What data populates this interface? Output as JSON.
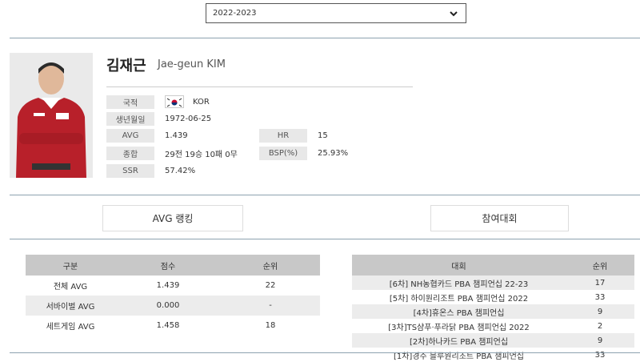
{
  "season": {
    "selected": "2022-2023"
  },
  "player": {
    "name_ko": "김재근",
    "name_en": "Jae-geun KIM",
    "info": {
      "nationality_label": "국적",
      "nationality_value": "KOR",
      "birth_label": "생년월일",
      "birth_value": "1972-06-25",
      "avg_label": "AVG",
      "avg_value": "1.439",
      "hr_label": "HR",
      "hr_value": "15",
      "total_label": "종합",
      "total_value": "29전 19승 10패 0무",
      "bsp_label": "BSP(%)",
      "bsp_value": "25.93%",
      "ssr_label": "SSR",
      "ssr_value": "57.42%"
    }
  },
  "tabs": {
    "avg_ranking": "AVG 랭킹",
    "tournaments": "참여대회"
  },
  "avg_table": {
    "headers": [
      "구분",
      "점수",
      "순위"
    ],
    "rows": [
      [
        "전체 AVG",
        "1.439",
        "22"
      ],
      [
        "서바이벌 AVG",
        "0.000",
        "-"
      ],
      [
        "세트게임 AVG",
        "1.458",
        "18"
      ]
    ]
  },
  "tour_table": {
    "headers": [
      "대회",
      "순위"
    ],
    "rows": [
      [
        "[6차] NH농협카드 PBA 챔피언십 22-23",
        "17"
      ],
      [
        "[5차] 하이원리조트 PBA 챔피언십 2022",
        "33"
      ],
      [
        "[4차]휴온스 PBA 챔피언십",
        "9"
      ],
      [
        "[3차]TS샴푸·푸라닭 PBA 챔피언십 2022",
        "2"
      ],
      [
        "[2차]하나카드 PBA 챔피언십",
        "9"
      ],
      [
        "[1차]경주 블루원리조트 PBA 챔피언십",
        "33"
      ]
    ]
  }
}
